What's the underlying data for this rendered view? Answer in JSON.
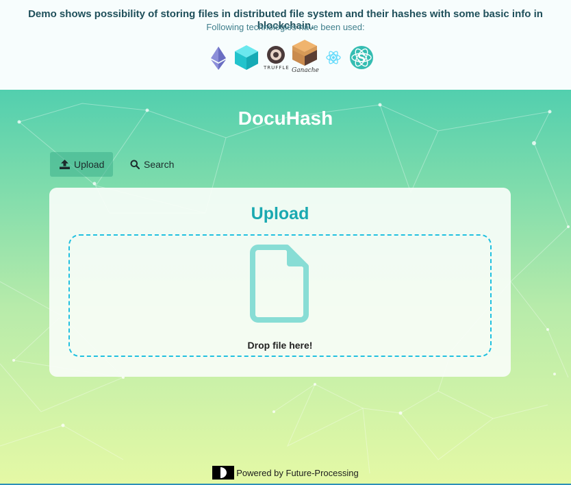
{
  "banner": {
    "title": "Demo shows possibility of storing files in distributed file system and their hashes with some basic info in blockchain.",
    "subtitle": "Following technologies have been used:",
    "logos": [
      {
        "icon": "ethereum-icon"
      },
      {
        "icon": "ipfs-cube-icon"
      },
      {
        "icon": "truffle-icon",
        "caption": "TRUFFLE"
      },
      {
        "icon": "ganache-icon",
        "caption": "Ganache"
      },
      {
        "icon": "react-icon"
      },
      {
        "icon": "semantic-ui-icon"
      }
    ]
  },
  "app": {
    "title": "DocuHash"
  },
  "nav": {
    "upload_label": "Upload",
    "search_label": "Search",
    "active": "upload"
  },
  "upload_card": {
    "title": "Upload",
    "drop_text": "Drop file here!"
  },
  "footer": {
    "text": "Powered by Future-Processing"
  },
  "colors": {
    "accent": "#1aa9b1",
    "dropzone_border": "#20c0e0",
    "file_icon": "#88ddd5",
    "gradient_top": "#52cfae",
    "gradient_bottom": "#e5f9a5"
  }
}
